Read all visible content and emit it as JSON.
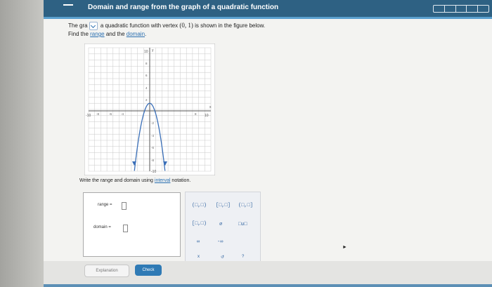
{
  "header": {
    "title": "Domain and range from the graph of a quadratic function"
  },
  "problem": {
    "line1_start": "The gra",
    "line1_mid": "a quadratic function with vertex",
    "vertex": "(0, 1)",
    "line1_end": "is shown in the figure below.",
    "line2_start": "Find the",
    "range_link": "range",
    "line2_and": "and the",
    "domain_link": "domain"
  },
  "graph": {
    "x_range": [
      -10,
      10
    ],
    "y_range": [
      -10,
      10
    ],
    "axis_labels": {
      "x_pos": "10",
      "x_neg": "-10",
      "y_pos": "10",
      "y_neg": "-10",
      "x_axis": "x",
      "y_axis": "y"
    },
    "ticks_top": [
      "8",
      "6",
      "4",
      "2"
    ],
    "ticks_left": [
      "-8",
      "-6",
      "-4"
    ],
    "ticks_bottom": [
      "-2",
      "-4",
      "-6",
      "-8"
    ],
    "ticks_right": [
      "8"
    ],
    "parabola_label": "quadratic with vertex (0,1), opening downward",
    "colors": {
      "grid": "#c9c9c9",
      "curve": "#3a6fb8",
      "axes": "#555555"
    }
  },
  "instruction": {
    "text_start": "Write the range and domain using",
    "link": "interval",
    "text_end": "notation."
  },
  "answers": {
    "range_label": "range =",
    "domain_label": "domain ="
  },
  "palette": {
    "row1": [
      "(□,□)",
      "[□,□]",
      "(□,□]"
    ],
    "row2": [
      "[□,□)",
      "∅",
      "□∪□"
    ],
    "row3": [
      "∞",
      "-∞"
    ],
    "row4": [
      "x",
      "↺",
      "?"
    ]
  },
  "buttons": {
    "explanation": "Explanation",
    "check": "Check"
  },
  "icons": {
    "menu": "menu-icon",
    "dropdown": "chevron-down-icon",
    "progress": "progress-icon",
    "cursor": "mouse-cursor-icon"
  }
}
